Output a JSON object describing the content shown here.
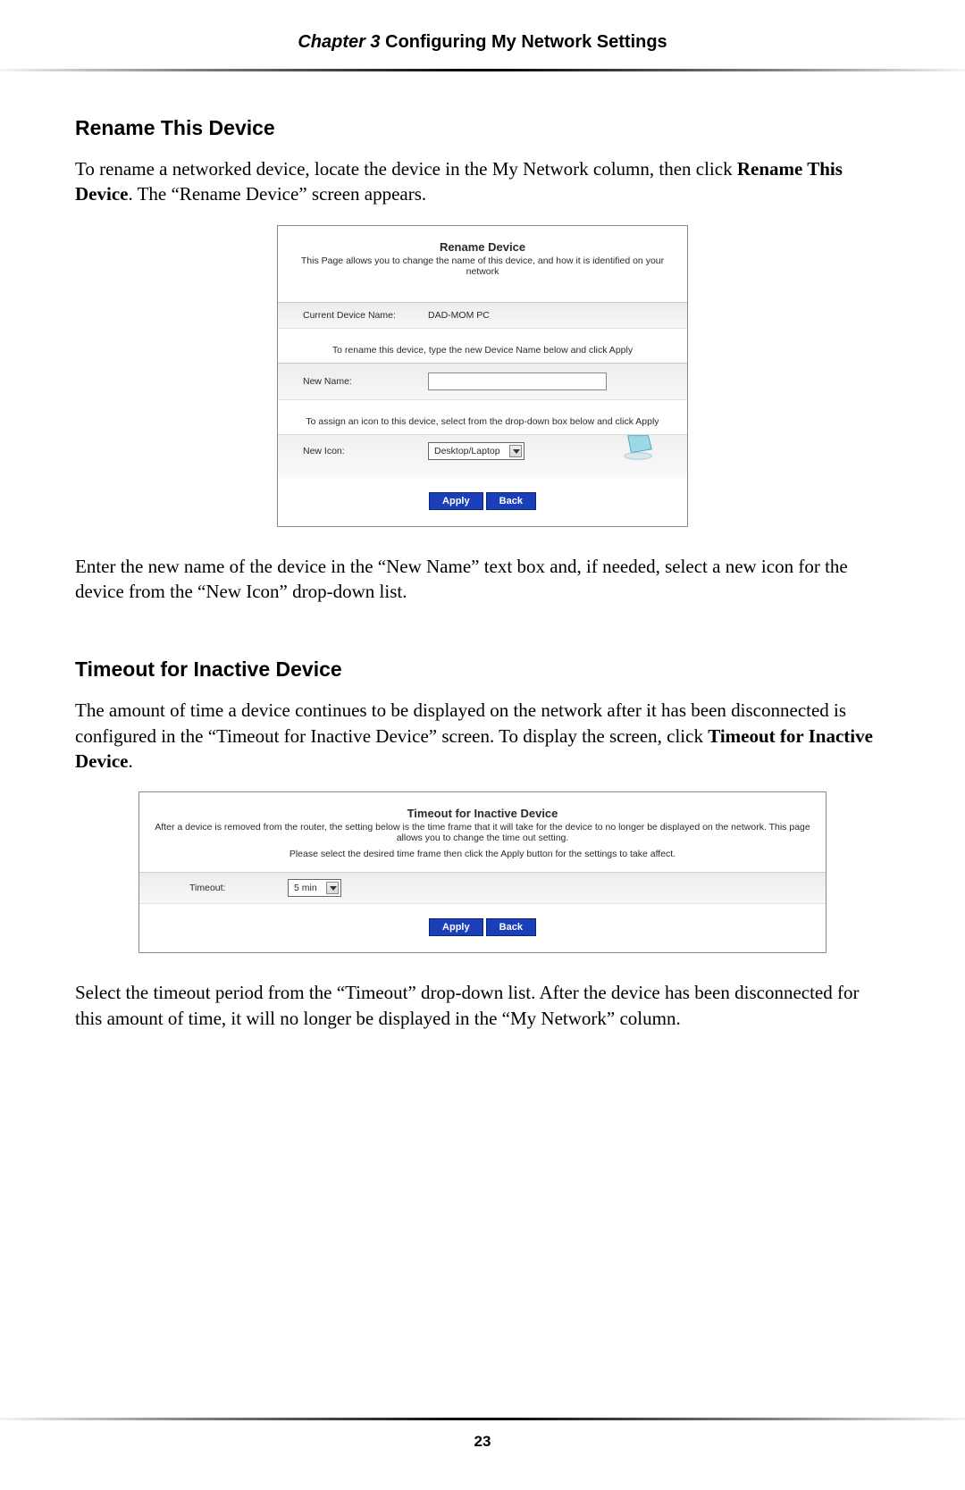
{
  "header": {
    "chapter_italic": "Chapter 3",
    "chapter_rest": "  Configuring My Network Settings"
  },
  "section1": {
    "heading": "Rename This Device",
    "para1_a": "To rename a networked device, locate the device in the My Network column, then click ",
    "para1_bold": "Rename This Device",
    "para1_b": ". The “Rename Device” screen appears.",
    "para2": "Enter the new name of the device in the “New Name” text box and, if needed, select a new icon for the device from the “New Icon” drop-down list."
  },
  "panel_rename": {
    "title": "Rename Device",
    "subtitle": "This Page allows you to change the name of this device, and how it is identified on your network",
    "current_label": "Current Device Name:",
    "current_value": "DAD-MOM PC",
    "rename_note": "To rename this device, type the new Device Name below and click Apply",
    "new_name_label": "New Name:",
    "new_name_value": "",
    "icon_note": "To assign an icon to this device, select from the drop-down box below and click Apply",
    "new_icon_label": "New Icon:",
    "new_icon_value": "Desktop/Laptop",
    "apply": "Apply",
    "back": "Back"
  },
  "section2": {
    "heading": "Timeout for Inactive Device",
    "para1_a": "The amount of time a device continues to be displayed on the network after it has been disconnected is configured in the “Timeout for Inactive Device” screen. To display the screen, click ",
    "para1_bold": "Timeout for Inactive Device",
    "para1_b": ".",
    "para2": "Select the timeout period from the “Timeout” drop-down list. After the device has been disconnected for this amount of time, it will no longer be displayed in the “My Network” column."
  },
  "panel_timeout": {
    "title": "Timeout for Inactive Device",
    "sub1": "After a device is removed from the router, the setting below is the time frame that it will take for the device to no longer be displayed on the network. This page allows you to change the time out setting.",
    "sub2": "Please select the desired time frame then click the Apply button for the settings to take affect.",
    "timeout_label": "Timeout:",
    "timeout_value": "5 min",
    "apply": "Apply",
    "back": "Back"
  },
  "page_number": "23"
}
